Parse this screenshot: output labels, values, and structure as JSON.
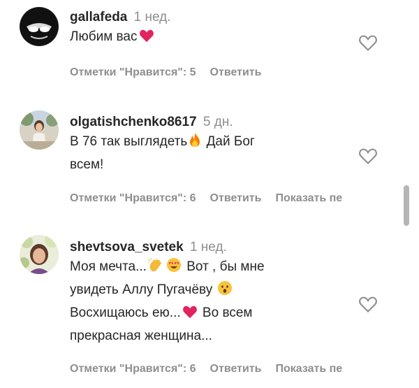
{
  "comments": [
    {
      "username": "gallafeda",
      "time": "1 нед.",
      "lines": [
        "Любим вас"
      ],
      "likes_label": "Отметки \"Нравится\": 5",
      "reply_label": "Ответить",
      "show_label": ""
    },
    {
      "username": "olgatishchenko8617",
      "time": "5 дн.",
      "lines": [
        "В 76 так выглядеть",
        "Дай Бог",
        "всем!"
      ],
      "likes_label": "Отметки \"Нравится\": 6",
      "reply_label": "Ответить",
      "show_label": "Показать пе"
    },
    {
      "username": "shevtsova_svetek",
      "time": "1 нед.",
      "lines": [
        "Моя мечта...",
        "Вот , бы мне",
        "увидеть Аллу Пугачёву",
        "Восхищаюсь ею...",
        "Во всем",
        "прекрасная женщина..."
      ],
      "likes_label": "Отметки \"Нравится\": 6",
      "reply_label": "Ответить",
      "show_label": "Показать пе"
    }
  ],
  "icons": {
    "like": "heart-outline-icon",
    "emoji_heart": "red-heart-emoji",
    "emoji_fire": "fire-emoji",
    "emoji_clap": "clapping-hands-emoji",
    "emoji_heart_eyes": "heart-eyes-emoji",
    "emoji_surprised": "surprised-face-emoji"
  },
  "colors": {
    "text": "#262626",
    "muted": "#8e8e8e",
    "heart": "#e0245e"
  }
}
